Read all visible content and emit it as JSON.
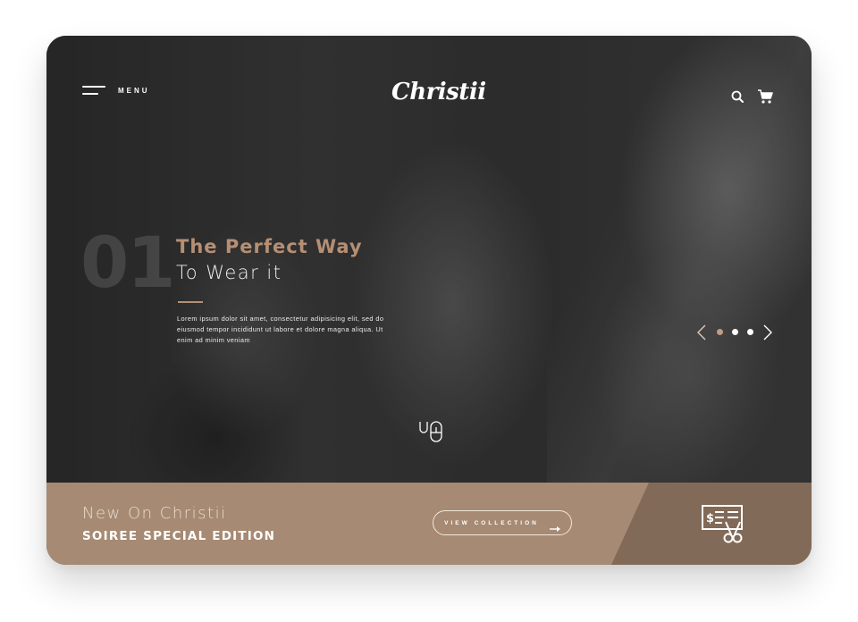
{
  "app": {
    "logo": "Christii"
  },
  "nav": {
    "menu_label": "MENU"
  },
  "hero": {
    "number": "01",
    "headline_line1": "The Perfect Way",
    "headline_line2": "To Wear it",
    "lorem": "Lorem ipsum dolor sit amet, consectetur adipisicing elit, sed do eiusmod tempor incididunt ut labore et dolore magna aliqua. Ut enim ad minim veniam",
    "slides": 3,
    "active_slide": 1
  },
  "collection": {
    "title": "New On Christii",
    "subtitle": "SOIREE SPECIAL EDITION",
    "button_label": "VIEW COLLECTION"
  },
  "icons": {
    "menu": "hamburger-icon",
    "search": "search-icon",
    "cart": "cart-icon",
    "prev": "chevron-left-icon",
    "next": "chevron-right-icon",
    "scroll": "mouse-scroll-icon",
    "button_arrow": "arrow-right-icon",
    "promo": "coupon-scissors-icon"
  },
  "colors": {
    "accent": "#b58f74",
    "strip_light": "#a68a73",
    "strip_dark": "#826a58"
  }
}
